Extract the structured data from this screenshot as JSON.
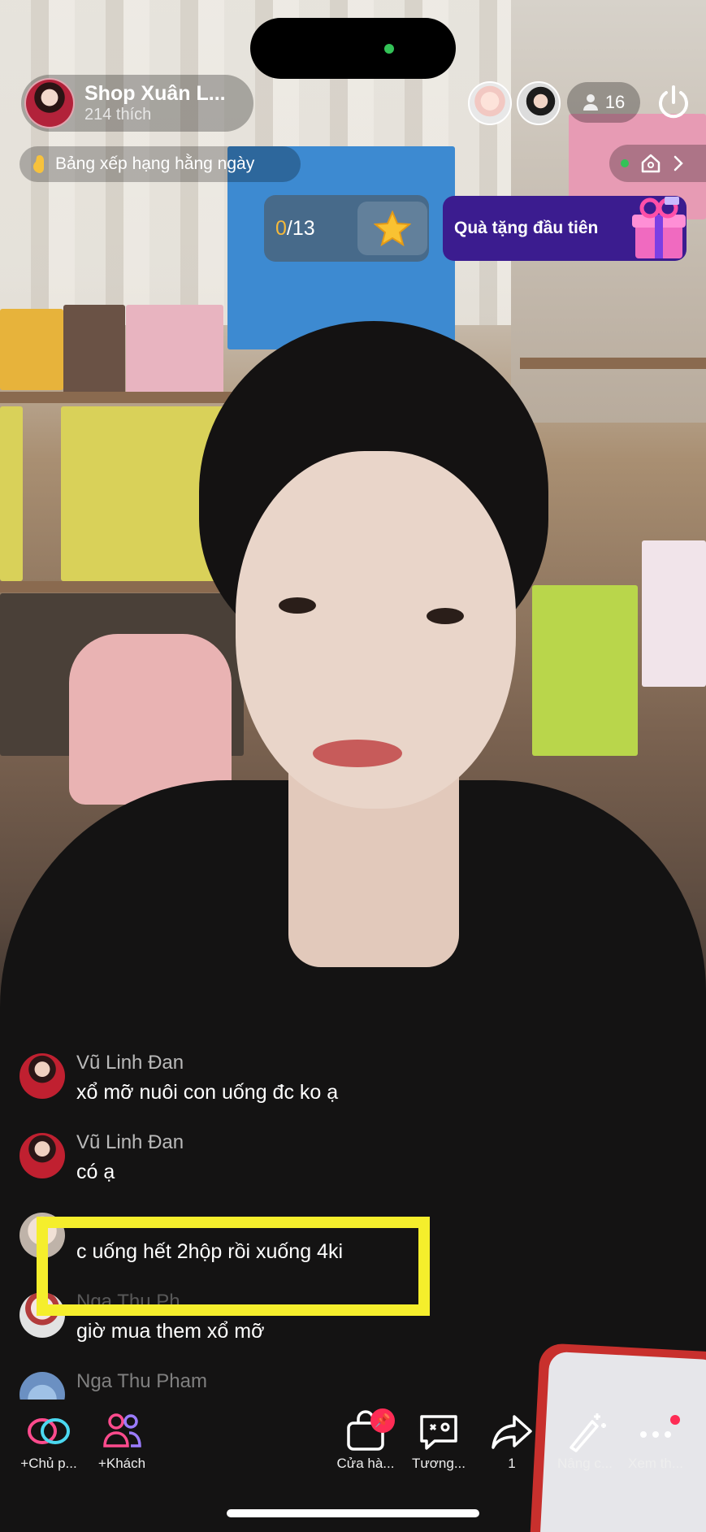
{
  "host": {
    "name": "Shop Xuân L...",
    "likes": "214 thích"
  },
  "viewers": {
    "count": "16"
  },
  "ranking": {
    "label": "Bảng xếp hạng hằng ngày"
  },
  "goal": {
    "current": "0",
    "total": "/13"
  },
  "gift_banner": {
    "label": "Quà tặng đầu tiên"
  },
  "chat": [
    {
      "name": "Vũ Linh Đan",
      "text": "xổ mỡ nuôi con uống đc ko ạ"
    },
    {
      "name": "Vũ Linh Đan",
      "text": "có ạ"
    },
    {
      "name": "",
      "text": "c uống hết 2hộp rồi xuống 4ki"
    },
    {
      "name": "Nga Thu Ph...",
      "text": "giờ mua them xổ mỡ"
    },
    {
      "name": "Nga Thu Pham",
      "text": ""
    }
  ],
  "bottom_bar": {
    "cohost": "+Chủ p...",
    "guests": "+Khách",
    "shop": "Cửa hà...",
    "interact": "Tương...",
    "share_count": "1",
    "enhance": "Nâng c...",
    "more": "Xem th..."
  },
  "colors": {
    "accent": "#fe2c55",
    "highlight": "#f5ee2c",
    "gift_banner": "#3b1c8f"
  }
}
